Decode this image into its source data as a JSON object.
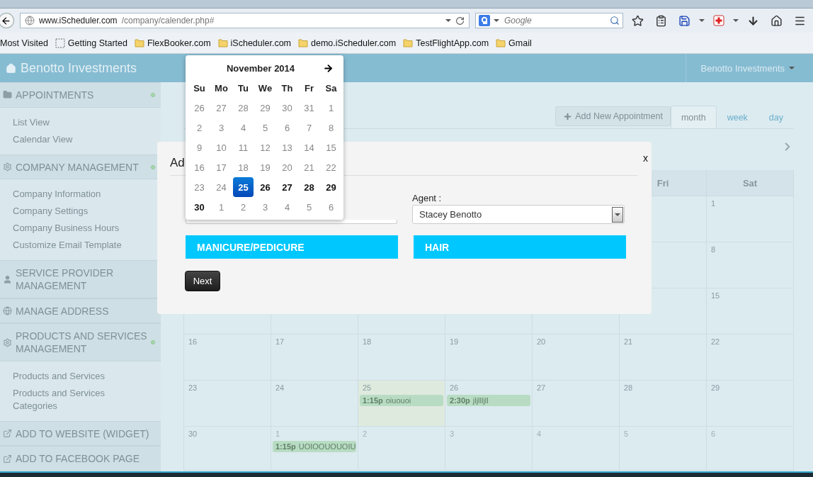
{
  "browser": {
    "url_domain": "www.iScheduler.com",
    "url_path": "/company/calender.php#",
    "search_placeholder": "Google",
    "bookmarks": [
      {
        "label": "Most Visited",
        "kind": "cut"
      },
      {
        "label": "Getting Started",
        "kind": "page"
      },
      {
        "label": "FlexBooker.com",
        "kind": "folder"
      },
      {
        "label": "iScheduler.com",
        "kind": "folder"
      },
      {
        "label": "demo.iScheduler.com",
        "kind": "folder"
      },
      {
        "label": "TestFlightApp.com",
        "kind": "folder"
      },
      {
        "label": "Gmail",
        "kind": "folder"
      }
    ]
  },
  "header": {
    "brand": "Benotto Investments",
    "user_menu": "Benotto Investments"
  },
  "sidebar": {
    "sections": [
      {
        "title": "APPOINTMENTS",
        "expanded": true,
        "items": [
          "List View",
          "Calendar View"
        ]
      },
      {
        "title": "COMPANY MANAGEMENT",
        "expanded": true,
        "items": [
          "Company Information",
          "Company Settings",
          "Company Business Hours",
          "Customize Email Template"
        ]
      },
      {
        "title": "SERVICE PROVIDER MANAGEMENT",
        "expanded": false
      },
      {
        "title": "MANAGE ADDRESS",
        "expanded": false
      },
      {
        "title": "PRODUCTS AND SERVICES MANAGEMENT",
        "expanded": true,
        "items": [
          "Products and Services",
          "Products and Services Categories"
        ]
      },
      {
        "title": "ADD TO WEBSITE (WIDGET)",
        "expanded": false
      },
      {
        "title": "ADD TO FACEBOOK PAGE",
        "expanded": false
      }
    ]
  },
  "calendar": {
    "add_button": "Add New Appointment",
    "views": [
      {
        "label": "month",
        "selected": true
      },
      {
        "label": "week",
        "selected": false
      },
      {
        "label": "day",
        "selected": false
      }
    ],
    "weekday_headers": [
      "Fri",
      "Sat"
    ],
    "weeks": [
      {
        "cells": [
          {
            "day": "1",
            "muted": false,
            "today": false
          }
        ]
      },
      {
        "cells": [
          {
            "day": "8",
            "muted": false,
            "today": false
          }
        ]
      },
      {
        "cells": [
          {
            "day": "15",
            "muted": false,
            "today": false
          }
        ]
      },
      {
        "cells": [
          {
            "day": "16",
            "muted": false,
            "today": false
          },
          {
            "day": "17",
            "muted": false,
            "today": false
          },
          {
            "day": "18",
            "muted": false,
            "today": false
          },
          {
            "day": "19",
            "muted": false,
            "today": false
          },
          {
            "day": "20",
            "muted": false,
            "today": false
          },
          {
            "day": "21",
            "muted": false,
            "today": false
          },
          {
            "day": "22",
            "muted": false,
            "today": false
          }
        ]
      },
      {
        "cells": [
          {
            "day": "23",
            "muted": false,
            "today": false
          },
          {
            "day": "24",
            "muted": false,
            "today": false
          },
          {
            "day": "25",
            "muted": false,
            "today": true,
            "events": [
              {
                "time": "1:15p",
                "title": "oiuouoi"
              }
            ]
          },
          {
            "day": "26",
            "muted": false,
            "today": false,
            "events": [
              {
                "time": "2:30p",
                "title": "jljllljll"
              }
            ]
          },
          {
            "day": "27",
            "muted": false,
            "today": false
          },
          {
            "day": "28",
            "muted": false,
            "today": false
          },
          {
            "day": "29",
            "muted": false,
            "today": false
          }
        ]
      },
      {
        "cells": [
          {
            "day": "30",
            "muted": false,
            "today": false
          },
          {
            "day": "1",
            "muted": true,
            "today": false,
            "events": [
              {
                "time": "1:15p",
                "title": "UOIOOUOUOIU"
              }
            ]
          },
          {
            "day": "2",
            "muted": true,
            "today": false
          },
          {
            "day": "3",
            "muted": true,
            "today": false
          },
          {
            "day": "4",
            "muted": true,
            "today": false
          },
          {
            "day": "5",
            "muted": true,
            "today": false
          },
          {
            "day": "6",
            "muted": true,
            "today": false
          }
        ]
      }
    ]
  },
  "modal": {
    "title": "Ad",
    "close": "x",
    "agent_label": "Agent :",
    "agent_value": "Stacey Benotto",
    "categories": [
      "MANICURE/PEDICURE",
      "HAIR"
    ],
    "next": "Next"
  },
  "datepicker": {
    "month": "November 2014",
    "weekdays": [
      "Su",
      "Mo",
      "Tu",
      "We",
      "Th",
      "Fr",
      "Sa"
    ],
    "weeks": [
      [
        {
          "d": "26",
          "muted": true,
          "selected": false
        },
        {
          "d": "27",
          "muted": true,
          "selected": false
        },
        {
          "d": "28",
          "muted": true,
          "selected": false
        },
        {
          "d": "29",
          "muted": true,
          "selected": false
        },
        {
          "d": "30",
          "muted": true,
          "selected": false
        },
        {
          "d": "31",
          "muted": true,
          "selected": false
        },
        {
          "d": "1",
          "muted": true,
          "selected": false
        }
      ],
      [
        {
          "d": "2",
          "muted": true,
          "selected": false
        },
        {
          "d": "3",
          "muted": true,
          "selected": false
        },
        {
          "d": "4",
          "muted": true,
          "selected": false
        },
        {
          "d": "5",
          "muted": true,
          "selected": false
        },
        {
          "d": "6",
          "muted": true,
          "selected": false
        },
        {
          "d": "7",
          "muted": true,
          "selected": false
        },
        {
          "d": "8",
          "muted": true,
          "selected": false
        }
      ],
      [
        {
          "d": "9",
          "muted": true,
          "selected": false
        },
        {
          "d": "10",
          "muted": true,
          "selected": false
        },
        {
          "d": "11",
          "muted": true,
          "selected": false
        },
        {
          "d": "12",
          "muted": true,
          "selected": false
        },
        {
          "d": "13",
          "muted": true,
          "selected": false
        },
        {
          "d": "14",
          "muted": true,
          "selected": false
        },
        {
          "d": "15",
          "muted": true,
          "selected": false
        }
      ],
      [
        {
          "d": "16",
          "muted": true,
          "selected": false
        },
        {
          "d": "17",
          "muted": true,
          "selected": false
        },
        {
          "d": "18",
          "muted": true,
          "selected": false
        },
        {
          "d": "19",
          "muted": true,
          "selected": false
        },
        {
          "d": "20",
          "muted": true,
          "selected": false
        },
        {
          "d": "21",
          "muted": true,
          "selected": false
        },
        {
          "d": "22",
          "muted": true,
          "selected": false
        }
      ],
      [
        {
          "d": "23",
          "muted": true,
          "selected": false
        },
        {
          "d": "24",
          "muted": true,
          "selected": false
        },
        {
          "d": "25",
          "muted": false,
          "selected": true
        },
        {
          "d": "26",
          "muted": false,
          "selected": false
        },
        {
          "d": "27",
          "muted": false,
          "selected": false
        },
        {
          "d": "28",
          "muted": false,
          "selected": false
        },
        {
          "d": "29",
          "muted": false,
          "selected": false
        }
      ],
      [
        {
          "d": "30",
          "muted": false,
          "selected": false
        },
        {
          "d": "1",
          "muted": true,
          "selected": false
        },
        {
          "d": "2",
          "muted": true,
          "selected": false
        },
        {
          "d": "3",
          "muted": true,
          "selected": false
        },
        {
          "d": "4",
          "muted": true,
          "selected": false
        },
        {
          "d": "5",
          "muted": true,
          "selected": false
        },
        {
          "d": "6",
          "muted": true,
          "selected": false
        }
      ]
    ]
  }
}
